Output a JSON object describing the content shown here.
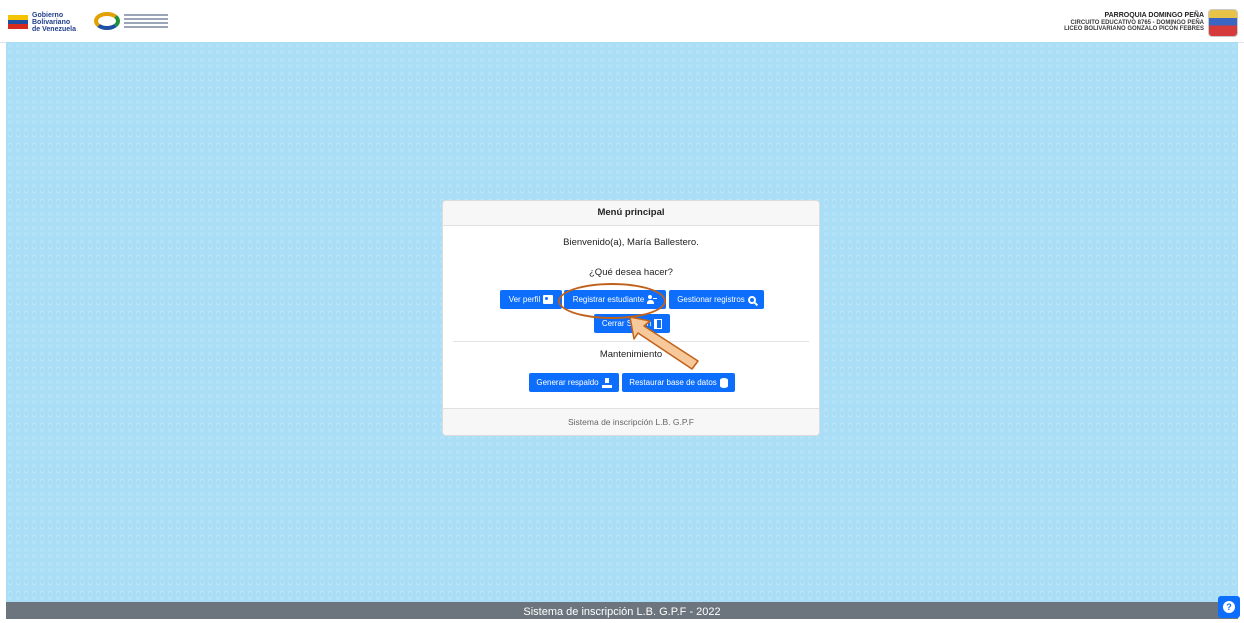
{
  "header": {
    "gov_logo_lines": [
      "Gobierno",
      "Bolivariano",
      "de Venezuela"
    ],
    "school_lines": [
      "PARROQUIA DOMINGO PEÑA",
      "CIRCUITO EDUCATIVO 8765 - DOMINGO PEÑA",
      "LICEO BOLIVARIANO GONZALO PICÓN FEBRES"
    ]
  },
  "card": {
    "title": "Menú principal",
    "welcome": "Bienvenido(a), María Ballestero.",
    "question": "¿Qué desea hacer?",
    "buttons": {
      "ver_perfil": "Ver perfil",
      "registrar_estudiante": "Registrar estudiante",
      "gestionar_registros": "Gestionar registros",
      "cerrar_sesion": "Cerrar Sesión"
    },
    "maintenance_title": "Mantenimiento",
    "maintenance_buttons": {
      "generar_respaldo": "Generar respaldo",
      "restaurar_bd": "Restaurar base de datos"
    },
    "footer": "Sistema de inscripción L.B. G.P.F"
  },
  "page_footer": "Sistema de inscripción L.B. G.P.F - 2022",
  "icons": {
    "ver_perfil": "id-card-icon",
    "registrar_estudiante": "user-plus-icon",
    "gestionar_registros": "search-icon",
    "cerrar_sesion": "door-open-icon",
    "generar_respaldo": "download-icon",
    "restaurar_bd": "database-icon",
    "help": "question-circle-icon"
  },
  "colors": {
    "primary": "#0d6efd",
    "background_pattern": "#a9def6",
    "footer": "#6c757d",
    "annotation": "#c0611a",
    "annotation_arrow_fill": "#f6c89a"
  }
}
